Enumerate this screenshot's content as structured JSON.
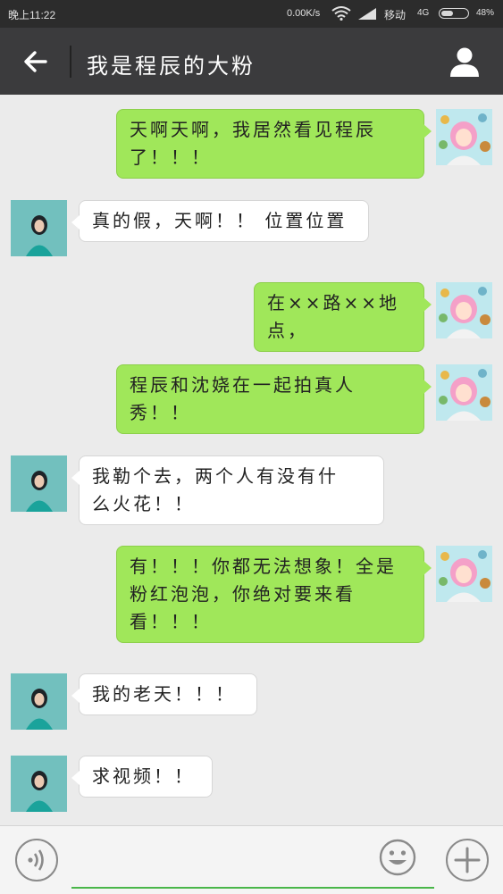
{
  "status_bar": {
    "time": "晚上11:22",
    "network_speed": "0.00K/s",
    "carrier": "移动",
    "generation": "4G",
    "battery_percent": "48%",
    "battery_level": 0.48
  },
  "header": {
    "title": "我是程辰的大粉",
    "back_icon": "back-arrow-icon",
    "profile_icon": "person-icon"
  },
  "messages": [
    {
      "sender": "me",
      "lines": [
        "天啊天啊，我居然看见程辰",
        "了！！！"
      ]
    },
    {
      "sender": "friend",
      "lines": [
        "真的假，天啊！！ 位置位置"
      ]
    },
    {
      "sender": "me",
      "lines": [
        "在××路××地点，"
      ]
    },
    {
      "sender": "me",
      "lines": [
        "程辰和沈娆在一起拍真人",
        "秀！！"
      ]
    },
    {
      "sender": "friend",
      "lines": [
        "我勒个去，两个人有没有什",
        "么火花！！"
      ]
    },
    {
      "sender": "me",
      "lines": [
        "有！！！你都无法想象！全是",
        "粉红泡泡，你绝对要来看",
        "看！！！"
      ]
    },
    {
      "sender": "friend",
      "lines": [
        "我的老天！！！"
      ]
    },
    {
      "sender": "friend",
      "lines": [
        "求视频！！"
      ]
    }
  ],
  "input_bar": {
    "voice_icon": "voice-icon",
    "emoji_icon": "emoji-icon",
    "plus_icon": "plus-icon",
    "text": ""
  },
  "colors": {
    "header_bg": "#3b3b3d",
    "my_bubble": "#a0e75a",
    "friend_bubble": "#ffffff",
    "chat_bg": "#ebebeb",
    "input_underline": "#49b649"
  }
}
